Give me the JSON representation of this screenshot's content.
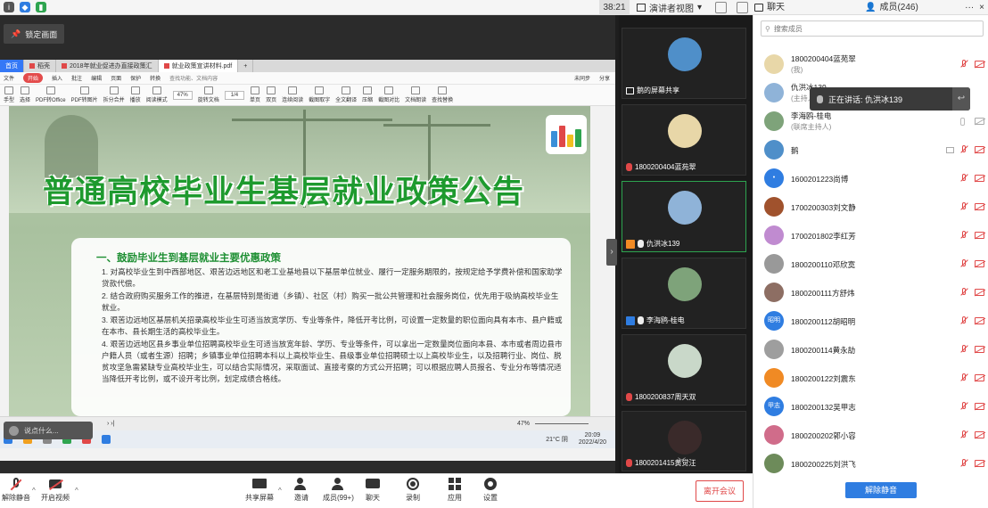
{
  "topbar": {
    "timer": "38:21",
    "view_mode": "演讲者视图",
    "chat_tab": "聊天",
    "members_tab": "成员(246)",
    "more": "···",
    "close": "×"
  },
  "share": {
    "lock_label": "锁定画面",
    "say_placeholder": "说点什么...",
    "wps": {
      "tabs": [
        "首页",
        "稻壳",
        "2018年就业促进办直接政策汇",
        "就业政策宣讲材料.pdf"
      ],
      "new_tab": "+",
      "menu": [
        "文件",
        "开始",
        "插入",
        "批注",
        "编辑",
        "页面",
        "保护",
        "转换",
        "查找功能、文档内容"
      ],
      "share_label": "分享",
      "menu_right": [
        "未同步"
      ],
      "tools": [
        "手型",
        "选择",
        "PDF转Office",
        "PDF转图片",
        "拆分合并",
        "播放",
        "阅读模式",
        "旋转文档",
        "单页",
        "双页",
        "连续阅读",
        "截图取字",
        "全文翻译",
        "压缩",
        "截图对比",
        "文档朗读",
        "朗读",
        "查找替换"
      ],
      "zoom": "47%",
      "page": "1/4",
      "status_zoom": "47%",
      "task_info": [
        "21°C 阴",
        "20:09",
        "2022/4/20"
      ]
    },
    "doc": {
      "title": "普通高校毕业生基层就业政策公告",
      "section": "一、鼓励毕业生到基层就业主要优惠政策",
      "items": [
        "1. 对高校毕业生到中西部地区、艰苦边远地区和老工业基地县以下基层单位就业、履行一定服务期限的，按规定给予学费补偿和国家助学贷款代偿。",
        "2. 结合政府购买服务工作的推进，在基层特别是街道（乡镇）、社区（村）购买一批公共管理和社会服务岗位，优先用于吸纳高校毕业生就业。",
        "3. 艰苦边远地区基层机关招录高校毕业生可适当放宽学历、专业等条件，降低开考比例，可设置一定数量的职位面向具有本市、县户籍或在本市、县长期生活的高校毕业生。",
        "4. 艰苦边远地区县乡事业单位招聘高校毕业生可适当放宽年龄、学历、专业等条件，可以拿出一定数量岗位面向本县、本市或者周边县市户籍人员（或者生源）招聘；乡镇事业单位招聘本科以上高校毕业生、县级事业单位招聘硕士以上高校毕业生，以及招聘行业、岗位、脱贫攻坚急需紧缺专业高校毕业生，可以结合实际情况，采取面试、直接考察的方式公开招聘；可以根据应聘人员报名、专业分布等情况适当降低开考比例，或不设开考比例，划定成绩合格线。"
      ]
    }
  },
  "gallery": {
    "tiles": [
      {
        "name": "鹅的屏幕共享",
        "avatar_color": "#4f8fc9"
      },
      {
        "name": "1800200404蓝苑翠",
        "avatar_color": "#e8d7a8"
      },
      {
        "name": "仇洪冰139",
        "avatar_color": "#8fb3d8"
      },
      {
        "name": "李海鸥-桂电",
        "avatar_color": "#7ea37a"
      },
      {
        "name": "1800200837周天双",
        "avatar_color": "#c9d8c9"
      },
      {
        "name": "1800201415黄觉汪",
        "avatar_color": "#3a2a2a"
      }
    ]
  },
  "speaking": "正在讲话: 仇洪冰139",
  "members": {
    "search_placeholder": "搜索成员",
    "list": [
      {
        "name": "1800200404蓝苑翠",
        "sub": "(我)",
        "avatar_color": "#e8d7a8",
        "avatar_text": ""
      },
      {
        "name": "仇洪冰139",
        "sub": "(主持人)",
        "avatar_color": "#8fb3d8",
        "avatar_text": ""
      },
      {
        "name": "李海鸥-桂电",
        "sub": "(联席主持人)",
        "avatar_color": "#7ea37a",
        "avatar_text": ""
      },
      {
        "name": "鹅",
        "sub": "",
        "avatar_color": "#4f8fc9",
        "avatar_text": ""
      },
      {
        "name": "1600201223尚博",
        "sub": "",
        "avatar_color": "#2f7de1",
        "avatar_text": "•"
      },
      {
        "name": "1700200303刘文静",
        "sub": "",
        "avatar_color": "#a0522d",
        "avatar_text": ""
      },
      {
        "name": "1700201802李红芳",
        "sub": "",
        "avatar_color": "#c08bd0",
        "avatar_text": ""
      },
      {
        "name": "1800200110邓欣寞",
        "sub": "",
        "avatar_color": "#999999",
        "avatar_text": ""
      },
      {
        "name": "1800200111方舒炜",
        "sub": "",
        "avatar_color": "#8d6e63",
        "avatar_text": ""
      },
      {
        "name": "1800200112胡昭明",
        "sub": "",
        "avatar_color": "#2f7de1",
        "avatar_text": "昭明"
      },
      {
        "name": "1800200114黄永劼",
        "sub": "",
        "avatar_color": "#9e9e9e",
        "avatar_text": ""
      },
      {
        "name": "1800200122刘震东",
        "sub": "",
        "avatar_color": "#f08a24",
        "avatar_text": ""
      },
      {
        "name": "1800200132吴甲志",
        "sub": "",
        "avatar_color": "#2f7de1",
        "avatar_text": "甲志"
      },
      {
        "name": "1800200202郭小容",
        "sub": "",
        "avatar_color": "#d06c8a",
        "avatar_text": ""
      },
      {
        "name": "1800200225刘洪飞",
        "sub": "",
        "avatar_color": "#6d8b5a",
        "avatar_text": ""
      }
    ],
    "unmute_all": "解除静音"
  },
  "bottombar": {
    "unmute": "解除静音",
    "start_video": "开启视频",
    "share_screen": "共享屏幕",
    "invite": "邀请",
    "members": "成员(99+)",
    "chat": "聊天",
    "record": "录制",
    "apps": "应用",
    "settings": "设置",
    "leave": "离开会议"
  }
}
